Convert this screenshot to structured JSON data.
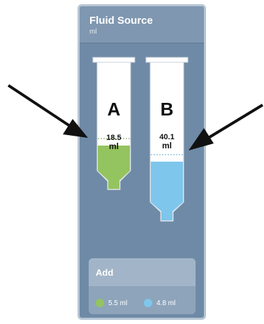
{
  "panel": {
    "title": "Fluid Source",
    "subtitle": "ml"
  },
  "syringes": [
    {
      "letter": "A",
      "volume": "18.5",
      "unit": "ml",
      "fill_fraction": 0.42,
      "color": "#94c45f"
    },
    {
      "letter": "B",
      "volume": "40.1",
      "unit": "ml",
      "fill_fraction": 0.58,
      "color": "#7ec6ec"
    }
  ],
  "add": {
    "title": "Add",
    "items": [
      {
        "label": "5.5 ml",
        "color": "#94c45f"
      },
      {
        "label": "4.8 ml",
        "color": "#7ec6ec"
      }
    ]
  }
}
